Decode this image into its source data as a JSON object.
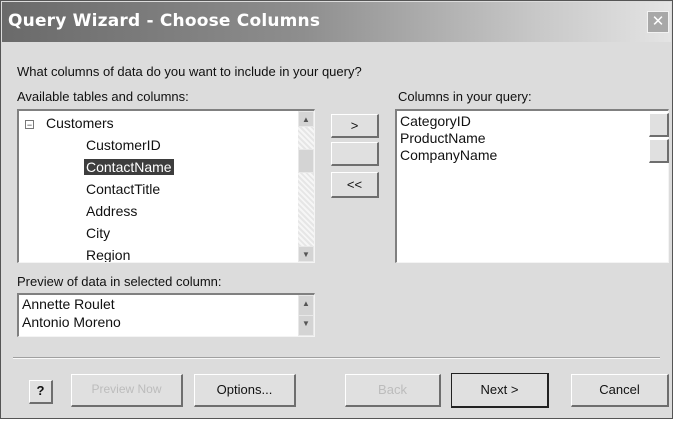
{
  "window": {
    "title": "Query Wizard - Choose Columns"
  },
  "prompt": "What columns of data do you want to include in your query?",
  "available": {
    "label": "Available tables and columns:",
    "table": "Customers",
    "columns": [
      "CustomerID",
      "ContactName",
      "ContactTitle",
      "Address",
      "City",
      "Region"
    ],
    "selected": "ContactName"
  },
  "move_buttons": {
    "add_one": ">",
    "remove_all": "<<"
  },
  "query_columns": {
    "label": "Columns in your query:",
    "items": [
      "CategoryID",
      "ProductName",
      "CompanyName"
    ]
  },
  "preview": {
    "label": "Preview of data in selected column:",
    "values": [
      "Annette Roulet",
      "Antonio Moreno"
    ]
  },
  "footer": {
    "help": "?",
    "preview_now": "Preview Now",
    "options": "Options...",
    "back": "Back",
    "next": "Next >",
    "cancel": "Cancel"
  },
  "icons": {
    "close": "close-icon",
    "collapse": "tree-collapse-icon",
    "scroll_up": "scroll-up-icon",
    "scroll_down": "scroll-down-icon",
    "help": "help-icon"
  }
}
